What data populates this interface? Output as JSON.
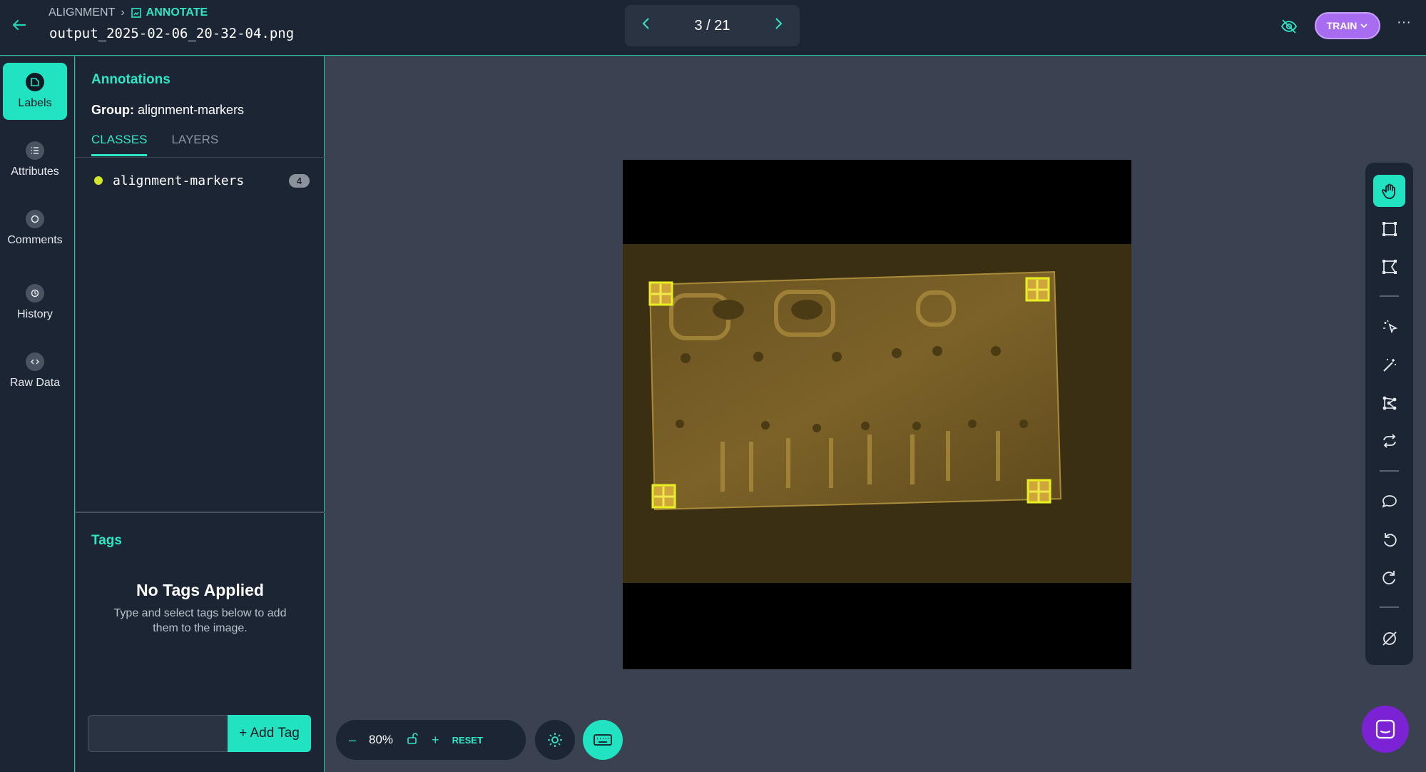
{
  "header": {
    "breadcrumb_project": "ALIGNMENT",
    "breadcrumb_mode": "ANNOTATE",
    "filename": "output_2025-02-06_20-32-04.png",
    "pager": "3 / 21",
    "train_label": "TRAIN",
    "more_label": "···"
  },
  "rail": [
    {
      "label": "Labels",
      "icon": "tag-icon",
      "active": true
    },
    {
      "label": "Attributes",
      "icon": "list-icon"
    },
    {
      "label": "Comments",
      "icon": "comment-icon"
    },
    {
      "label": "History",
      "icon": "history-icon"
    },
    {
      "label": "Raw Data",
      "icon": "code-icon"
    }
  ],
  "annotations": {
    "title": "Annotations",
    "group_label": "Group:",
    "group_value": "alignment-markers",
    "tab_classes": "CLASSES",
    "tab_layers": "LAYERS",
    "classes": [
      {
        "name": "alignment-markers",
        "count": "4",
        "color": "#d4e62a"
      }
    ]
  },
  "tags": {
    "title": "Tags",
    "empty_title": "No Tags Applied",
    "empty_text": "Type and select tags below to add them to the image.",
    "input_placeholder": "",
    "add_label": "+ Add Tag"
  },
  "zoom": {
    "minus": "–",
    "level": "80%",
    "plus": "+",
    "reset": "RESET"
  },
  "colors": {
    "accent": "#22e3c1",
    "panel": "#1c2533",
    "workspace": "#3a4150",
    "train": "#a86cf0",
    "marker": "#d4e62a"
  },
  "toolbar": [
    "pan-hand-icon",
    "bounding-box-icon",
    "polygon-icon",
    "smart-select-icon",
    "magic-wand-icon",
    "keypoints-icon",
    "repeat-icon",
    "comment-icon",
    "undo-icon",
    "redo-icon",
    "hide-annotations-icon"
  ]
}
